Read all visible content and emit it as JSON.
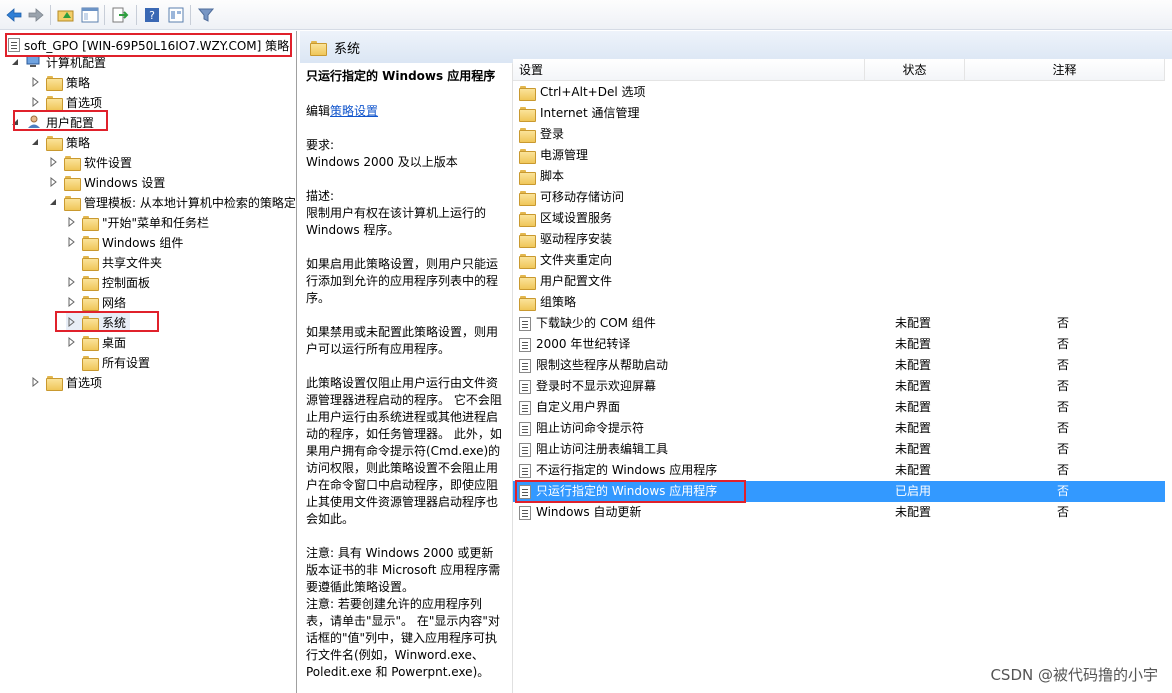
{
  "toolbar": {
    "buttons": [
      "back-arrow-icon",
      "forward-arrow-icon",
      "up-folder-icon",
      "show-hide-tree-icon",
      "export-list-icon",
      "help-icon",
      "properties-icon",
      "filter-icon"
    ]
  },
  "tree": {
    "root": "soft_GPO [WIN-69P50L16IO7.WZY.COM] 策略",
    "computer_config": "计算机配置",
    "computer_policies": "策略",
    "computer_preferences": "首选项",
    "user_config": "用户配置",
    "user_policies": "策略",
    "software_settings": "软件设置",
    "windows_settings": "Windows 设置",
    "admin_templates": "管理模板: 从本地计算机中检索的策略定",
    "start_menu": "\"开始\"菜单和任务栏",
    "windows_components": "Windows 组件",
    "shared_folders": "共享文件夹",
    "control_panel": "控制面板",
    "network": "网络",
    "system": "系统",
    "desktop": "桌面",
    "all_settings": "所有设置",
    "user_preferences": "首选项"
  },
  "header": {
    "title": "系统"
  },
  "description": {
    "title": "只运行指定的 Windows 应用程序",
    "edit_prefix": "编辑",
    "edit_link": "策略设置",
    "requirements_label": "要求:",
    "requirements": "Windows 2000 及以上版本",
    "desc_label": "描述:",
    "desc1": "限制用户有权在该计算机上运行的 Windows 程序。",
    "desc2": "如果启用此策略设置，则用户只能运行添加到允许的应用程序列表中的程序。",
    "desc3": "如果禁用或未配置此策略设置，则用户可以运行所有应用程序。",
    "desc4": "此策略设置仅阻止用户运行由文件资源管理器进程启动的程序。 它不会阻止用户运行由系统进程或其他进程启动的程序，如任务管理器。 此外，如果用户拥有命令提示符(Cmd.exe)的访问权限，则此策略设置不会阻止用户在命令窗口中启动程序，即使应阻止其使用文件资源管理器启动程序也会如此。",
    "note1": "注意: 具有 Windows 2000 或更新版本证书的非 Microsoft 应用程序需要遵循此策略设置。",
    "note2": "注意: 若要创建允许的应用程序列表，请单击\"显示\"。 在\"显示内容\"对话框的\"值\"列中，键入应用程序可执行文件名(例如，Winword.exe、Poledit.exe 和 Powerpnt.exe)。"
  },
  "grid": {
    "col_setting": "设置",
    "col_state": "状态",
    "col_note": "注释",
    "rows": [
      {
        "name": "Ctrl+Alt+Del 选项",
        "state": "",
        "note": "",
        "kind": "folder"
      },
      {
        "name": "Internet 通信管理",
        "state": "",
        "note": "",
        "kind": "folder"
      },
      {
        "name": "登录",
        "state": "",
        "note": "",
        "kind": "folder"
      },
      {
        "name": "电源管理",
        "state": "",
        "note": "",
        "kind": "folder"
      },
      {
        "name": "脚本",
        "state": "",
        "note": "",
        "kind": "folder"
      },
      {
        "name": "可移动存储访问",
        "state": "",
        "note": "",
        "kind": "folder"
      },
      {
        "name": "区域设置服务",
        "state": "",
        "note": "",
        "kind": "folder"
      },
      {
        "name": "驱动程序安装",
        "state": "",
        "note": "",
        "kind": "folder"
      },
      {
        "name": "文件夹重定向",
        "state": "",
        "note": "",
        "kind": "folder"
      },
      {
        "name": "用户配置文件",
        "state": "",
        "note": "",
        "kind": "folder"
      },
      {
        "name": "组策略",
        "state": "",
        "note": "",
        "kind": "folder"
      },
      {
        "name": "下载缺少的 COM 组件",
        "state": "未配置",
        "note": "否",
        "kind": "policy"
      },
      {
        "name": "2000 年世纪转译",
        "state": "未配置",
        "note": "否",
        "kind": "policy"
      },
      {
        "name": "限制这些程序从帮助启动",
        "state": "未配置",
        "note": "否",
        "kind": "policy"
      },
      {
        "name": "登录时不显示欢迎屏幕",
        "state": "未配置",
        "note": "否",
        "kind": "policy"
      },
      {
        "name": "自定义用户界面",
        "state": "未配置",
        "note": "否",
        "kind": "policy"
      },
      {
        "name": "阻止访问命令提示符",
        "state": "未配置",
        "note": "否",
        "kind": "policy"
      },
      {
        "name": "阻止访问注册表编辑工具",
        "state": "未配置",
        "note": "否",
        "kind": "policy"
      },
      {
        "name": "不运行指定的 Windows 应用程序",
        "state": "未配置",
        "note": "否",
        "kind": "policy"
      },
      {
        "name": "只运行指定的 Windows 应用程序",
        "state": "已启用",
        "note": "否",
        "kind": "policy",
        "selected": true
      },
      {
        "name": "Windows 自动更新",
        "state": "未配置",
        "note": "否",
        "kind": "policy"
      }
    ]
  },
  "watermark": "CSDN @被代码撸的小宇",
  "colors": {
    "selection": "#3399ff",
    "highlight_box": "#e0212b",
    "link": "#1155cc"
  }
}
